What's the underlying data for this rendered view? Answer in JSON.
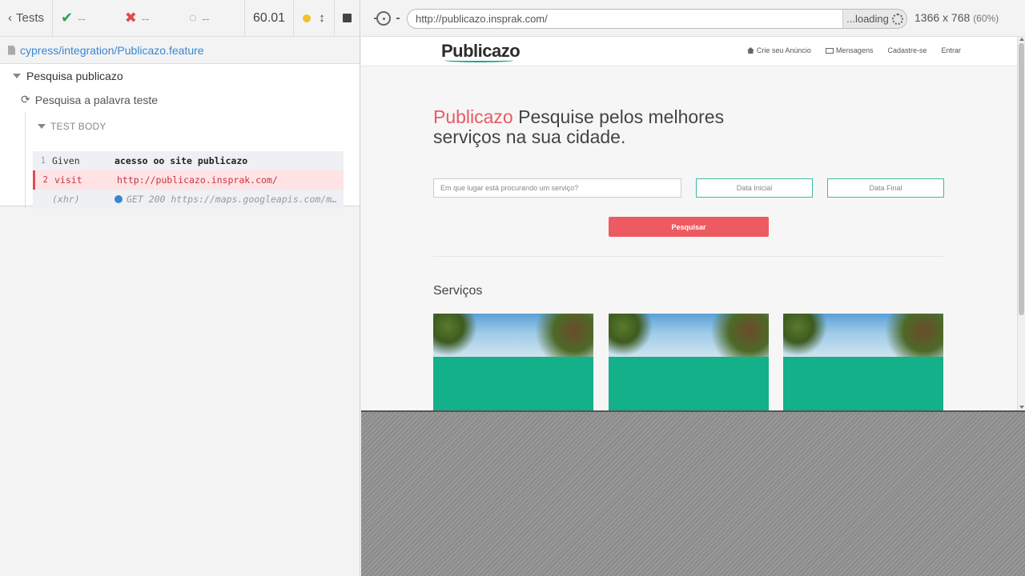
{
  "reporter": {
    "tests_label": "Tests",
    "passed": "--",
    "failed": "--",
    "pending": "--",
    "duration": "60.01",
    "spec_path": "cypress/integration/Publicazo.feature",
    "suite_title": "Pesquisa publicazo",
    "test_title": "Pesquisa a palavra teste",
    "test_body_label": "TEST BODY",
    "commands": [
      {
        "num": "1",
        "name": "Given",
        "message": "acesso oo site publicazo"
      },
      {
        "num": "2",
        "name": "visit",
        "message": "http://publicazo.insprak.com/"
      },
      {
        "num": "",
        "name": "(xhr)",
        "message": "GET 200 https://maps.googleapis.com/m…"
      }
    ]
  },
  "aut": {
    "url": "http://publicazo.insprak.com/",
    "loading_label": "...loading",
    "viewport": "1366 x 768",
    "scale": "(60%)"
  },
  "site": {
    "logo": "Publicazo",
    "nav": [
      "Crie seu Anúncio",
      "Mensagens",
      "Cadastre-se",
      "Entrar"
    ],
    "hero_brand": "Publicazo",
    "hero_text": " Pesquise pelos melhores serviços na sua cidade.",
    "search_placeholder": "Em que lugar está procurando um serviço?",
    "date_start": "Data Inicial",
    "date_end": "Data Final",
    "search_button": "Pesquisar",
    "services_title": "Serviços"
  },
  "colors": {
    "brand_red": "#e95a63",
    "teal": "#13b089",
    "link_blue": "#3a86d1",
    "fail_red": "#c8333f"
  }
}
